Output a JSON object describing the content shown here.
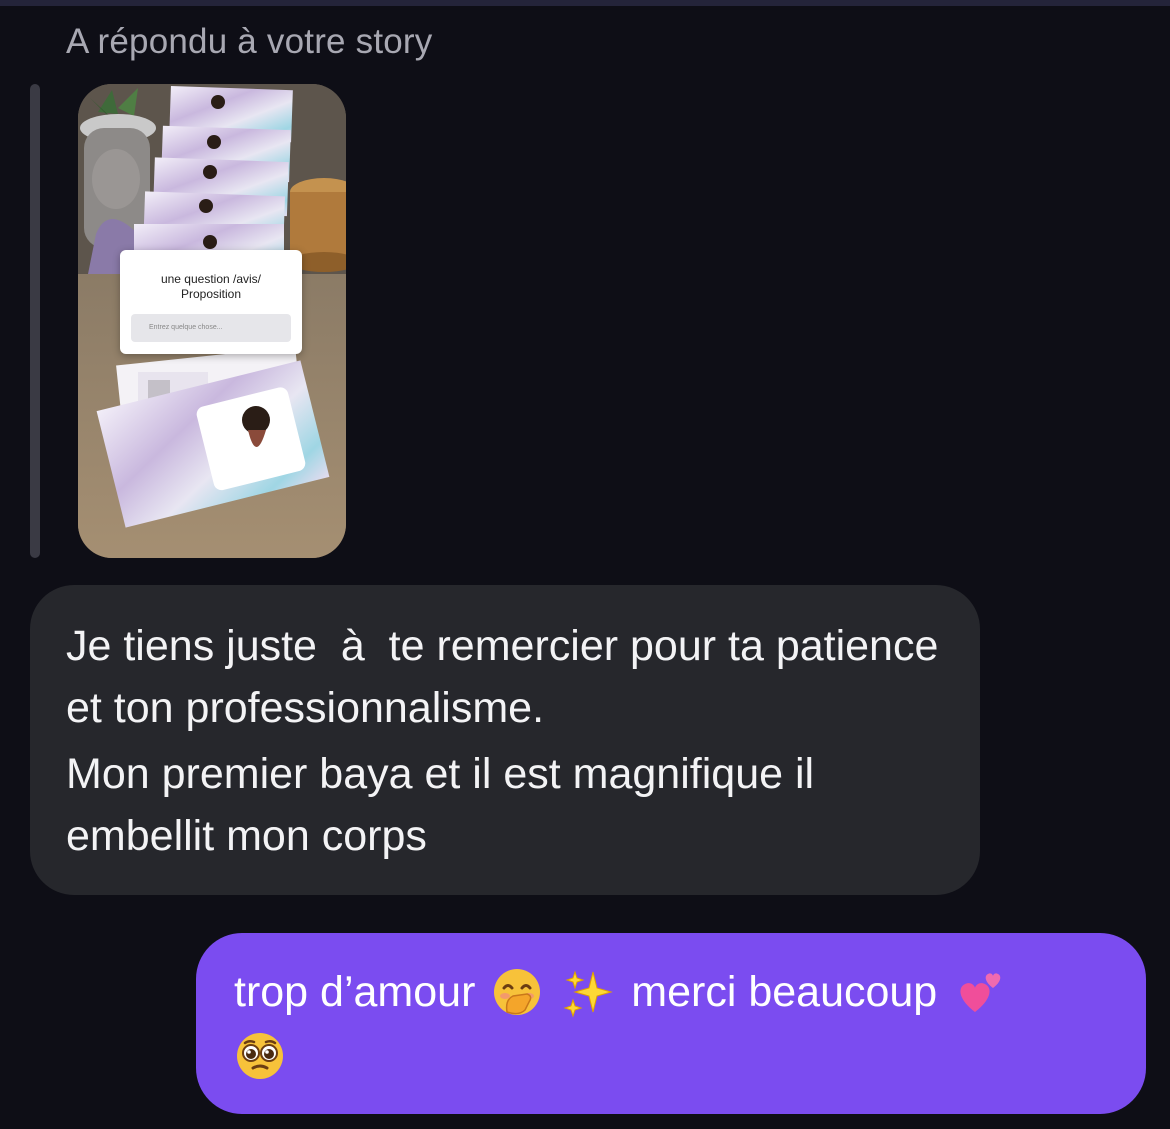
{
  "header": {
    "reply_caption": "A répondu à votre story"
  },
  "story": {
    "question_text": "une question /avis/ Proposition",
    "input_placeholder": "Entrez quelque chose..."
  },
  "messages": {
    "received": {
      "paragraph1": "Je tiens juste  à  te remercier pour ta patience et ton professionnalisme.",
      "paragraph2": "Mon premier baya et il est magnifique il embellit mon corps"
    },
    "sent": {
      "text_part1": "trop d’amour",
      "text_part2": "merci beaucoup",
      "emojis": [
        "face-with-hand-over-mouth-icon",
        "sparkles-icon",
        "two-hearts-icon",
        "pleading-face-icon"
      ]
    }
  },
  "colors": {
    "background": "#0e0e16",
    "received_bubble": "#26272c",
    "sent_bubble": "#7b4cf0",
    "caption_text": "#a8a8b2"
  }
}
